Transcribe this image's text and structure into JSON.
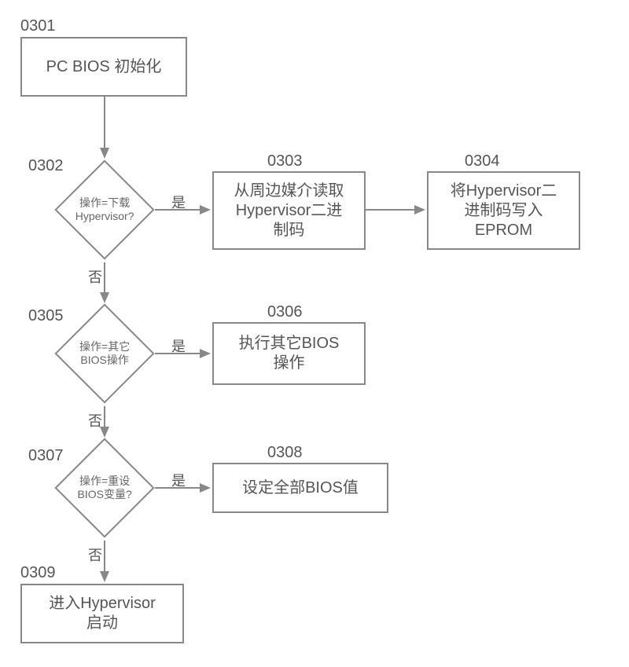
{
  "nodes": {
    "n0301": {
      "ref": "0301",
      "text": "PC BIOS 初始化"
    },
    "n0302": {
      "ref": "0302",
      "text": "操作=下载\nHypervisor?"
    },
    "n0303": {
      "ref": "0303",
      "text": "从周边媒介读取\nHypervisor二进\n制码"
    },
    "n0304": {
      "ref": "0304",
      "text": "将Hypervisor二\n进制码写入\nEPROM"
    },
    "n0305": {
      "ref": "0305",
      "text": "操作=其它\nBIOS操作"
    },
    "n0306": {
      "ref": "0306",
      "text": "执行其它BIOS\n操作"
    },
    "n0307": {
      "ref": "0307",
      "text": "操作=重设\nBIOS变量?"
    },
    "n0308": {
      "ref": "0308",
      "text": "设定全部BIOS值"
    },
    "n0309": {
      "ref": "0309",
      "text": "进入Hypervisor\n启动"
    }
  },
  "edge_labels": {
    "yes": "是",
    "no": "否"
  }
}
